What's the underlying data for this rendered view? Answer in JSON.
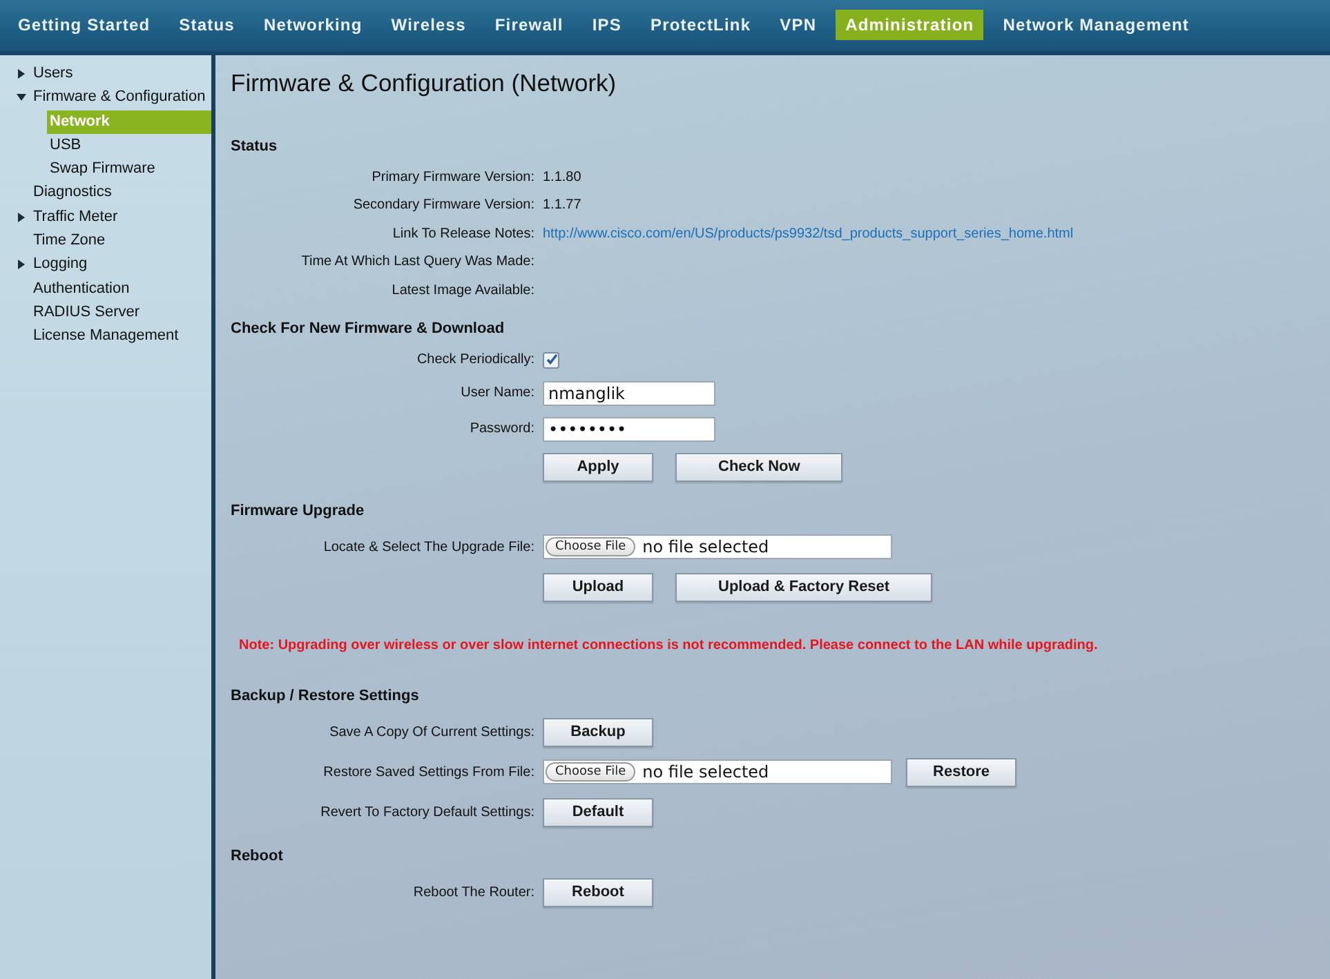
{
  "nav": {
    "tabs": [
      {
        "label": "Getting Started",
        "selected": false
      },
      {
        "label": "Status",
        "selected": false
      },
      {
        "label": "Networking",
        "selected": false
      },
      {
        "label": "Wireless",
        "selected": false
      },
      {
        "label": "Firewall",
        "selected": false
      },
      {
        "label": "IPS",
        "selected": false
      },
      {
        "label": "ProtectLink",
        "selected": false
      },
      {
        "label": "VPN",
        "selected": false
      },
      {
        "label": "Administration",
        "selected": true
      },
      {
        "label": "Network Management",
        "selected": false
      }
    ]
  },
  "sidebar": {
    "items": [
      {
        "label": "Users",
        "expanded": false,
        "selected": false
      },
      {
        "label": "Firmware & Configuration",
        "expanded": true,
        "selected": false,
        "children": [
          {
            "label": "Network",
            "selected": true
          },
          {
            "label": "USB",
            "selected": false
          },
          {
            "label": "Swap Firmware",
            "selected": false
          }
        ]
      },
      {
        "label": "Diagnostics",
        "selected": false
      },
      {
        "label": "Traffic Meter",
        "expanded": false,
        "selected": false
      },
      {
        "label": "Time Zone",
        "selected": false
      },
      {
        "label": "Logging",
        "expanded": false,
        "selected": false
      },
      {
        "label": "Authentication",
        "selected": false
      },
      {
        "label": "RADIUS Server",
        "selected": false
      },
      {
        "label": "License Management",
        "selected": false
      }
    ]
  },
  "page_title": "Firmware & Configuration (Network)",
  "sections": [
    {
      "title": "Status",
      "rows": [
        {
          "kind": "value",
          "label": "Primary Firmware Version:",
          "value": "1.1.80"
        },
        {
          "kind": "value",
          "label": "Secondary Firmware Version:",
          "value": "1.1.77"
        },
        {
          "kind": "link",
          "label": "Link To Release Notes:",
          "value": "http://www.cisco.com/en/US/products/ps9932/tsd_products_support_series_home.html"
        },
        {
          "kind": "value",
          "label": "Time At Which Last Query Was Made:"
        },
        {
          "kind": "value",
          "label": "Latest Image Available:"
        }
      ]
    },
    {
      "title": "Check For New Firmware & Download",
      "rows": [
        {
          "kind": "checkbox",
          "label": "Check Periodically:",
          "checked": true
        },
        {
          "kind": "input",
          "label": "User Name:",
          "value": "nmanglik"
        },
        {
          "kind": "input",
          "label": "Password:",
          "value": "••••••••"
        },
        {
          "kind": "buttons",
          "buttons": [
            "Apply",
            "Check Now"
          ]
        }
      ]
    },
    {
      "title": "Firmware Upgrade",
      "rows": [
        {
          "kind": "file",
          "label": "Locate & Select The Upgrade File:",
          "button": "Choose File",
          "status": "no file selected"
        },
        {
          "kind": "buttons",
          "buttons": [
            "Upload",
            "Upload & Factory Reset"
          ]
        },
        {
          "kind": "note",
          "text": "Note: Upgrading over wireless or over slow internet connections is not recommended. Please connect to the LAN while upgrading."
        }
      ]
    },
    {
      "title": "Backup / Restore Settings",
      "rows": [
        {
          "kind": "buttons",
          "label": "Save A Copy Of Current Settings:",
          "buttons": [
            "Backup"
          ]
        },
        {
          "kind": "file",
          "label": "Restore Saved Settings From File:",
          "button": "Choose File",
          "status": "no file selected",
          "action": "Restore"
        },
        {
          "kind": "buttons",
          "label": "Revert To Factory Default Settings:",
          "buttons": [
            "Default"
          ]
        }
      ]
    },
    {
      "title": "Reboot",
      "rows": [
        {
          "kind": "buttons",
          "label": "Reboot The Router:",
          "buttons": [
            "Reboot"
          ]
        }
      ]
    }
  ]
}
